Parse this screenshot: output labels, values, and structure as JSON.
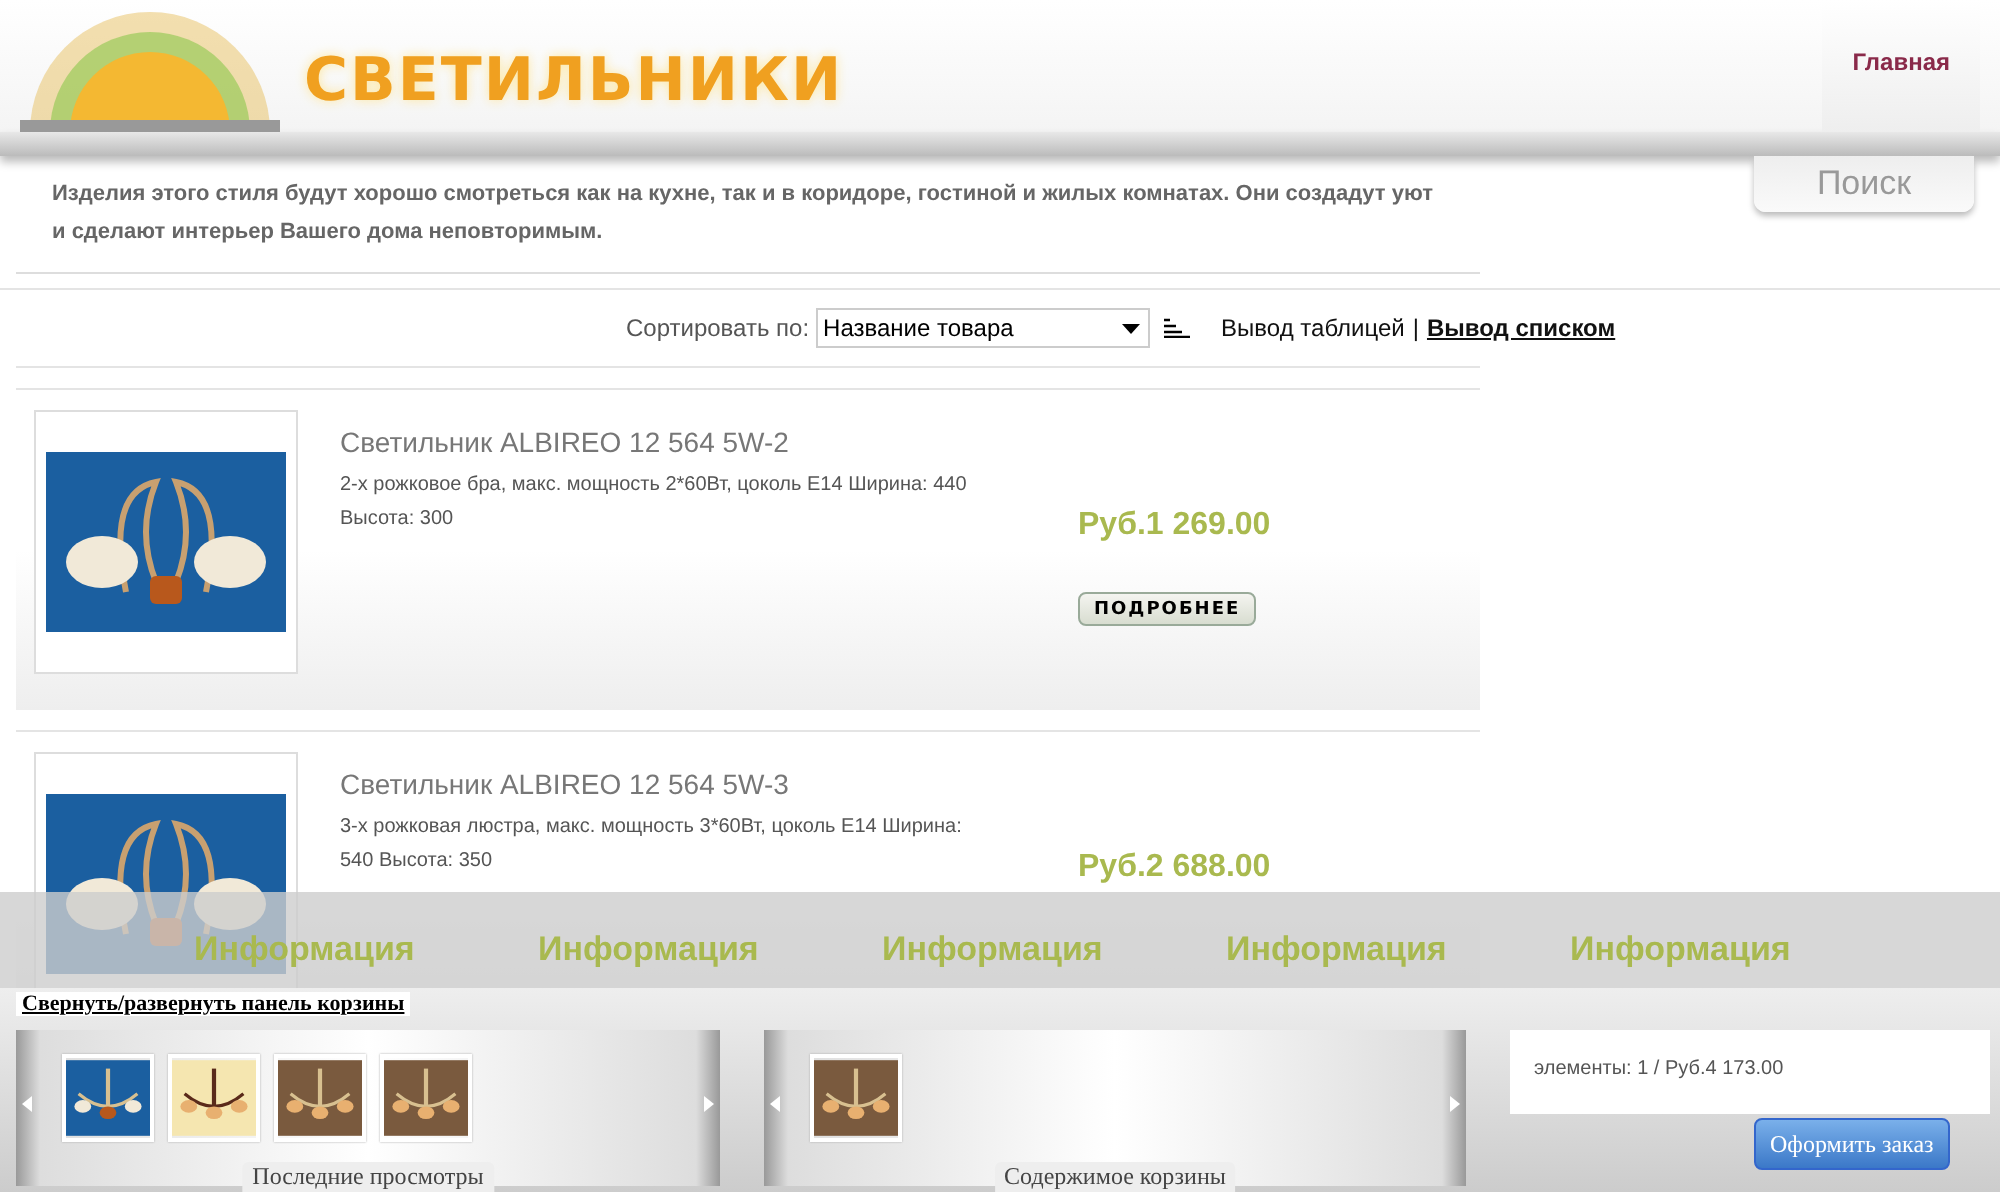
{
  "header": {
    "logo_text": "СВЕТИЛЬНИКИ",
    "nav": [
      {
        "label": "Главная",
        "selected": true
      }
    ],
    "search_button": "Поиск"
  },
  "description": "Изделия этого стиля будут хорошо смотреться как на кухне, так и в коридоре, гостиной и жилых комнатах. Они создадут уют и сделают интерьер Вашего дома неповторимым.",
  "sort": {
    "label": "Сортировать по:",
    "value": "Название товара",
    "separator": "|",
    "view_options": [
      {
        "label": "Вывод таблицей",
        "selected": false
      },
      {
        "label": "Вывод списком",
        "selected": true
      }
    ]
  },
  "products": [
    {
      "title": "Светильник ALBIREO 12 564 5W-2",
      "description": "2-х рожковое бра, макс. мощность 2*60Вт, цоколь E14 Ширина: 440 Высота: 300",
      "price": "Руб.1 269.00",
      "button": "ПОДРОБНЕЕ"
    },
    {
      "title": "Светильник ALBIREO 12 564 5W-3",
      "description": "3-х рожковая люстра, макс. мощность 3*60Вт, цоколь E14 Ширина: 540 Высота: 350",
      "price": "Руб.2 688.00"
    }
  ],
  "info_bar": [
    "Информация",
    "Информация",
    "Информация",
    "Информация",
    "Информация"
  ],
  "cart_panel": {
    "toggle": "Свернуть/развернуть панель корзины",
    "recent": {
      "title": "Последние просмотры"
    },
    "cart": {
      "title": "Содержимое корзины"
    },
    "summary": "элементы: 1 / Руб.4 173.00",
    "checkout_button": "Оформить заказ"
  }
}
